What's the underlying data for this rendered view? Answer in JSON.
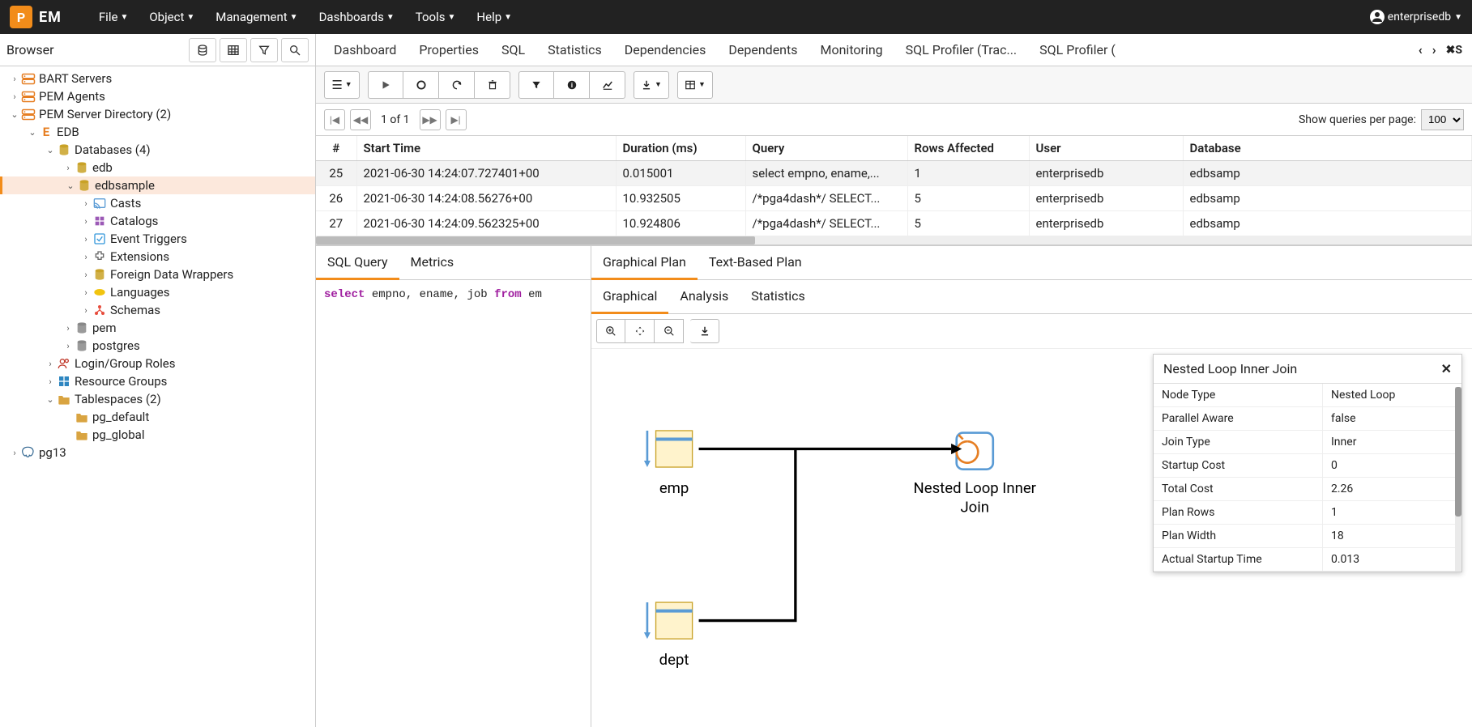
{
  "topmenu": {
    "items": [
      "File",
      "Object",
      "Management",
      "Dashboards",
      "Tools",
      "Help"
    ],
    "user": "enterprisedb"
  },
  "browser": {
    "title": "Browser",
    "tree": [
      {
        "d": 0,
        "exp": "closed",
        "icon": "server",
        "label": "BART Servers"
      },
      {
        "d": 0,
        "exp": "closed",
        "icon": "server",
        "label": "PEM Agents"
      },
      {
        "d": 0,
        "exp": "open",
        "icon": "server",
        "label": "PEM Server Directory (2)"
      },
      {
        "d": 1,
        "exp": "open",
        "icon": "e",
        "label": "EDB"
      },
      {
        "d": 2,
        "exp": "open",
        "icon": "db",
        "label": "Databases (4)"
      },
      {
        "d": 3,
        "exp": "closed",
        "icon": "db",
        "label": "edb"
      },
      {
        "d": 3,
        "exp": "open",
        "icon": "db",
        "label": "edbsample",
        "sel": true
      },
      {
        "d": 4,
        "exp": "closed",
        "icon": "cast",
        "label": "Casts"
      },
      {
        "d": 4,
        "exp": "closed",
        "icon": "cat",
        "label": "Catalogs"
      },
      {
        "d": 4,
        "exp": "closed",
        "icon": "evt",
        "label": "Event Triggers"
      },
      {
        "d": 4,
        "exp": "closed",
        "icon": "ext",
        "label": "Extensions"
      },
      {
        "d": 4,
        "exp": "closed",
        "icon": "fdw",
        "label": "Foreign Data Wrappers"
      },
      {
        "d": 4,
        "exp": "closed",
        "icon": "lang",
        "label": "Languages"
      },
      {
        "d": 4,
        "exp": "closed",
        "icon": "schema",
        "label": "Schemas"
      },
      {
        "d": 3,
        "exp": "closed",
        "icon": "grey",
        "label": "pem"
      },
      {
        "d": 3,
        "exp": "closed",
        "icon": "grey",
        "label": "postgres"
      },
      {
        "d": 2,
        "exp": "closed",
        "icon": "role",
        "label": "Login/Group Roles"
      },
      {
        "d": 2,
        "exp": "closed",
        "icon": "res",
        "label": "Resource Groups"
      },
      {
        "d": 2,
        "exp": "open",
        "icon": "folder",
        "label": "Tablespaces (2)"
      },
      {
        "d": 3,
        "exp": "none",
        "icon": "folder",
        "label": "pg_default"
      },
      {
        "d": 3,
        "exp": "none",
        "icon": "folder",
        "label": "pg_global"
      },
      {
        "d": 0,
        "exp": "closed",
        "icon": "pg",
        "label": "pg13"
      }
    ]
  },
  "tabs": [
    "Dashboard",
    "Properties",
    "SQL",
    "Statistics",
    "Dependencies",
    "Dependents",
    "Monitoring",
    "SQL Profiler (Trac...",
    "SQL Profiler ("
  ],
  "pager": {
    "text": "1 of 1",
    "perpage_label": "Show queries per page:",
    "perpage": "100"
  },
  "grid": {
    "headers": [
      "#",
      "Start Time",
      "Duration (ms)",
      "Query",
      "Rows Affected",
      "User",
      "Database"
    ],
    "rows": [
      {
        "n": "25",
        "t": "2021-06-30 14:24:07.727401+00",
        "d": "0.015001",
        "q": "select empno, ename,...",
        "r": "1",
        "u": "enterprisedb",
        "db": "edbsamp",
        "sel": true
      },
      {
        "n": "26",
        "t": "2021-06-30 14:24:08.56276+00",
        "d": "10.932505",
        "q": "/*pga4dash*/ SELECT...",
        "r": "5",
        "u": "enterprisedb",
        "db": "edbsamp"
      },
      {
        "n": "27",
        "t": "2021-06-30 14:24:09.562325+00",
        "d": "10.924806",
        "q": "/*pga4dash*/ SELECT...",
        "r": "5",
        "u": "enterprisedb",
        "db": "edbsamp"
      }
    ]
  },
  "sql_tabs": [
    "SQL Query",
    "Metrics"
  ],
  "sql_code": {
    "select": "select",
    "fields": " empno, ename, job ",
    "from": "from",
    "rest": " em"
  },
  "plan_tabs_top": [
    "Graphical Plan",
    "Text-Based Plan"
  ],
  "plan_tabs_sub": [
    "Graphical",
    "Analysis",
    "Statistics"
  ],
  "plan_nodes": {
    "emp": "emp",
    "dept": "dept",
    "join": "Nested Loop Inner Join"
  },
  "popup": {
    "title": "Nested Loop Inner Join",
    "rows": [
      {
        "k": "Node Type",
        "v": "Nested Loop"
      },
      {
        "k": "Parallel Aware",
        "v": "false"
      },
      {
        "k": "Join Type",
        "v": "Inner"
      },
      {
        "k": "Startup Cost",
        "v": "0"
      },
      {
        "k": "Total Cost",
        "v": "2.26"
      },
      {
        "k": "Plan Rows",
        "v": "1"
      },
      {
        "k": "Plan Width",
        "v": "18"
      },
      {
        "k": "Actual Startup Time",
        "v": "0.013"
      }
    ]
  }
}
